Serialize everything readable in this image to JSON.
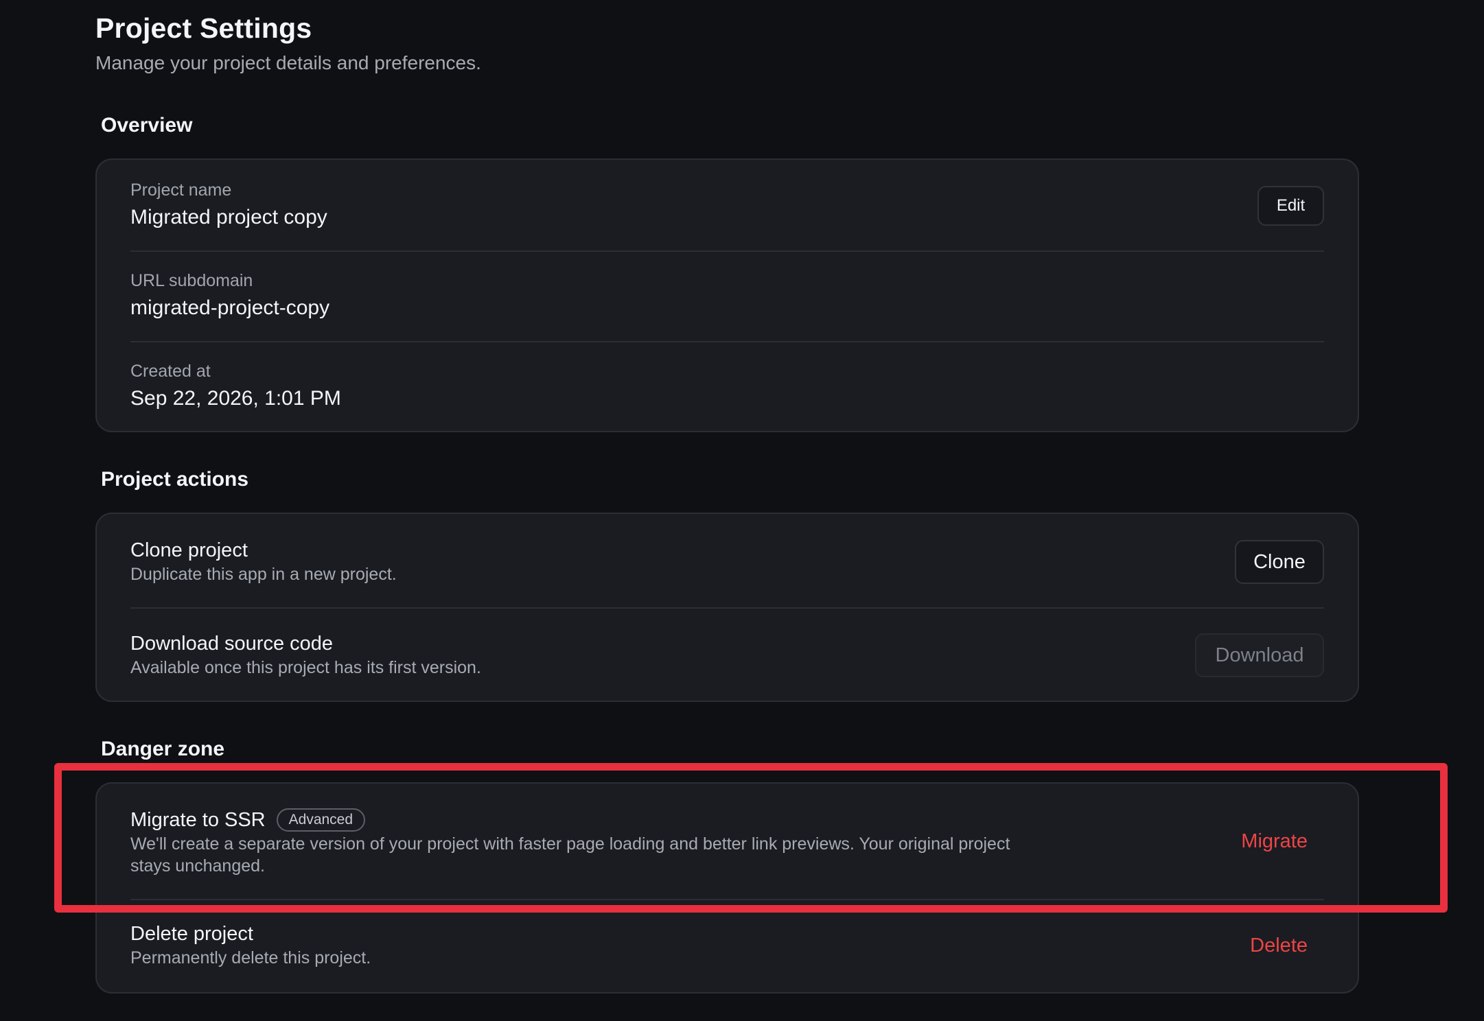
{
  "header": {
    "title": "Project Settings",
    "subtitle": "Manage your project details and preferences."
  },
  "overview": {
    "section_title": "Overview",
    "fields": [
      {
        "label": "Project name",
        "value": "Migrated project copy"
      },
      {
        "label": "URL subdomain",
        "value": "migrated-project-copy"
      },
      {
        "label": "Created at",
        "value": "Sep 22, 2026, 1:01 PM"
      }
    ],
    "edit_label": "Edit"
  },
  "project_actions": {
    "section_title": "Project actions",
    "clone": {
      "title": "Clone project",
      "description": "Duplicate this app in a new project.",
      "button": "Clone"
    },
    "download": {
      "title": "Download source code",
      "description": "Available once this project has its first version.",
      "button": "Download"
    }
  },
  "danger_zone": {
    "section_title": "Danger zone",
    "migrate": {
      "title": "Migrate to SSR",
      "badge": "Advanced",
      "description_line1": "We'll create a separate version of your project with faster page loading and better link previews. Your original project",
      "description_line2": "stays unchanged.",
      "button": "Migrate"
    },
    "delete": {
      "title": "Delete project",
      "description": "Permanently delete this project.",
      "button": "Delete"
    }
  },
  "colors": {
    "background": "#0f1014",
    "card": "#1a1c22",
    "danger": "#ef4444",
    "highlight": "#e8303f"
  }
}
